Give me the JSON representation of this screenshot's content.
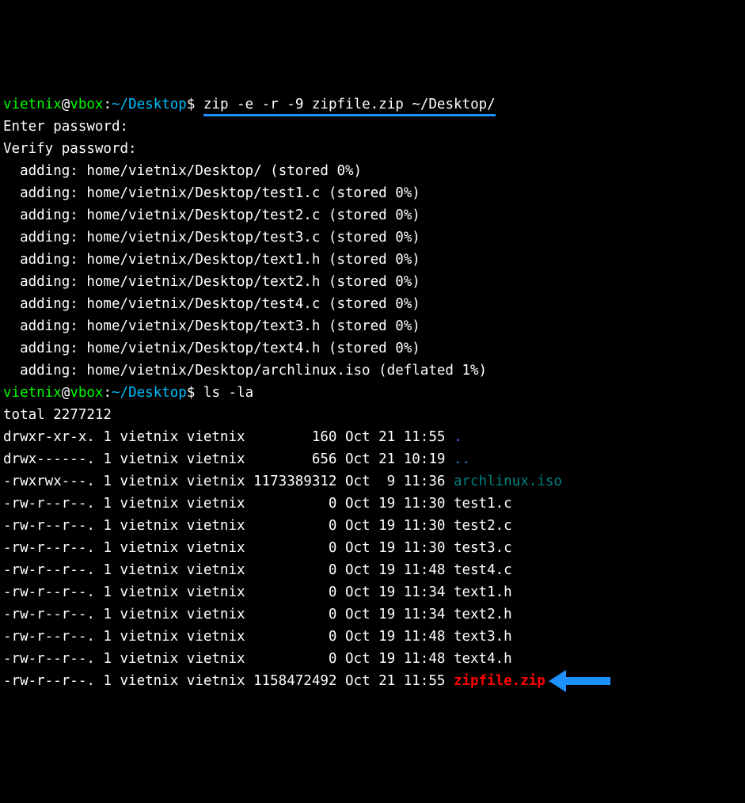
{
  "prompt1": {
    "user": "vietnix",
    "at": "@",
    "host": "vbox",
    "sep1": ":",
    "path": "~/Desktop",
    "sep2": "$ ",
    "command": "zip -e -r -9 zipfile.zip ~/Desktop/"
  },
  "enter_pw": "Enter password: ",
  "verify_pw": "Verify password: ",
  "adding": [
    {
      "prefix": "  adding: ",
      "path": "home/vietnix/Desktop/",
      "suffix": " (stored 0%)"
    },
    {
      "prefix": "  adding: ",
      "path": "home/vietnix/Desktop/test1.c",
      "suffix": " (stored 0%)"
    },
    {
      "prefix": "  adding: ",
      "path": "home/vietnix/Desktop/test2.c",
      "suffix": " (stored 0%)"
    },
    {
      "prefix": "  adding: ",
      "path": "home/vietnix/Desktop/test3.c",
      "suffix": " (stored 0%)"
    },
    {
      "prefix": "  adding: ",
      "path": "home/vietnix/Desktop/text1.h",
      "suffix": " (stored 0%)"
    },
    {
      "prefix": "  adding: ",
      "path": "home/vietnix/Desktop/text2.h",
      "suffix": " (stored 0%)"
    },
    {
      "prefix": "  adding: ",
      "path": "home/vietnix/Desktop/test4.c",
      "suffix": " (stored 0%)"
    },
    {
      "prefix": "  adding: ",
      "path": "home/vietnix/Desktop/text3.h",
      "suffix": " (stored 0%)"
    },
    {
      "prefix": "  adding: ",
      "path": "home/vietnix/Desktop/text4.h",
      "suffix": " (stored 0%)"
    },
    {
      "prefix": "  adding: ",
      "path": "home/vietnix/Desktop/archlinux.iso",
      "suffix": " (deflated 1%)"
    }
  ],
  "prompt2": {
    "user": "vietnix",
    "at": "@",
    "host": "vbox",
    "sep1": ":",
    "path": "~/Desktop",
    "sep2": "$ ",
    "command": "ls -la"
  },
  "total_line": "total 2277212",
  "ls": [
    {
      "meta": "drwxr-xr-x. 1 vietnix vietnix        160 Oct 21 11:55 ",
      "name": ".",
      "cls": "c-dot-blue"
    },
    {
      "meta": "drwx------. 1 vietnix vietnix        656 Oct 21 10:19 ",
      "name": "..",
      "cls": "c-ddot-blue"
    },
    {
      "meta": "-rwxrwx---. 1 vietnix vietnix 1173389312 Oct  9 11:36 ",
      "name": "archlinux.iso",
      "cls": "c-archlinux"
    },
    {
      "meta": "-rw-r--r--. 1 vietnix vietnix          0 Oct 19 11:30 ",
      "name": "test1.c",
      "cls": "c-white"
    },
    {
      "meta": "-rw-r--r--. 1 vietnix vietnix          0 Oct 19 11:30 ",
      "name": "test2.c",
      "cls": "c-white"
    },
    {
      "meta": "-rw-r--r--. 1 vietnix vietnix          0 Oct 19 11:30 ",
      "name": "test3.c",
      "cls": "c-white"
    },
    {
      "meta": "-rw-r--r--. 1 vietnix vietnix          0 Oct 19 11:48 ",
      "name": "test4.c",
      "cls": "c-white"
    },
    {
      "meta": "-rw-r--r--. 1 vietnix vietnix          0 Oct 19 11:34 ",
      "name": "text1.h",
      "cls": "c-white"
    },
    {
      "meta": "-rw-r--r--. 1 vietnix vietnix          0 Oct 19 11:34 ",
      "name": "text2.h",
      "cls": "c-white"
    },
    {
      "meta": "-rw-r--r--. 1 vietnix vietnix          0 Oct 19 11:48 ",
      "name": "text3.h",
      "cls": "c-white"
    },
    {
      "meta": "-rw-r--r--. 1 vietnix vietnix          0 Oct 19 11:48 ",
      "name": "text4.h",
      "cls": "c-white"
    },
    {
      "meta": "-rw-r--r--. 1 vietnix vietnix 1158472492 Oct 21 11:55 ",
      "name": "zipfile.zip",
      "cls": "c-zipfile"
    }
  ]
}
